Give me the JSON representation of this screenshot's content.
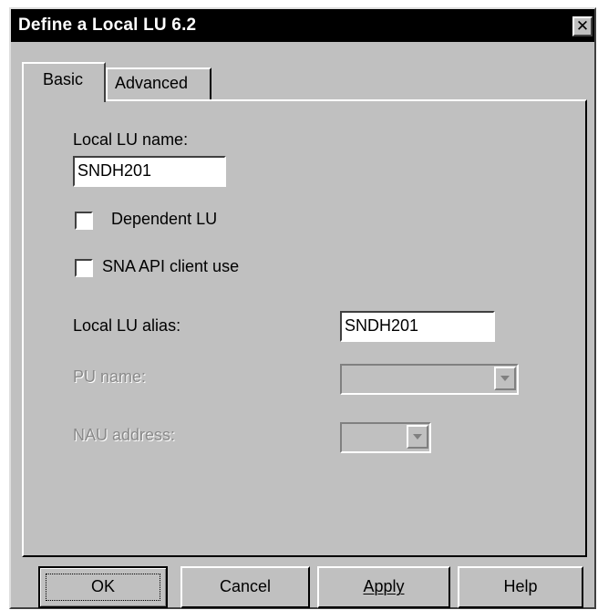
{
  "window": {
    "title": "Define a Local LU 6.2",
    "close_glyph": "✕"
  },
  "tabs": [
    {
      "label": "Basic",
      "selected": true
    },
    {
      "label": "Advanced",
      "selected": false
    }
  ],
  "form": {
    "local_lu_name": {
      "label": "Local LU name:",
      "value": "SNDH201"
    },
    "dependent_lu": {
      "label": "Dependent LU",
      "checked": false
    },
    "sna_api_client_use": {
      "label": "SNA API client use",
      "checked": false
    },
    "local_lu_alias": {
      "label": "Local LU alias:",
      "value": "SNDH201"
    },
    "pu_name": {
      "label": "PU name:",
      "value": "",
      "disabled": true
    },
    "nau_address": {
      "label": "NAU address:",
      "value": "",
      "disabled": true
    }
  },
  "buttons": {
    "ok": "OK",
    "cancel": "Cancel",
    "apply": "Apply",
    "help": "Help"
  },
  "colors": {
    "dialog_face": "#c0c0c0",
    "titlebar": "#000000",
    "disabled_text": "#8a8a8a"
  }
}
